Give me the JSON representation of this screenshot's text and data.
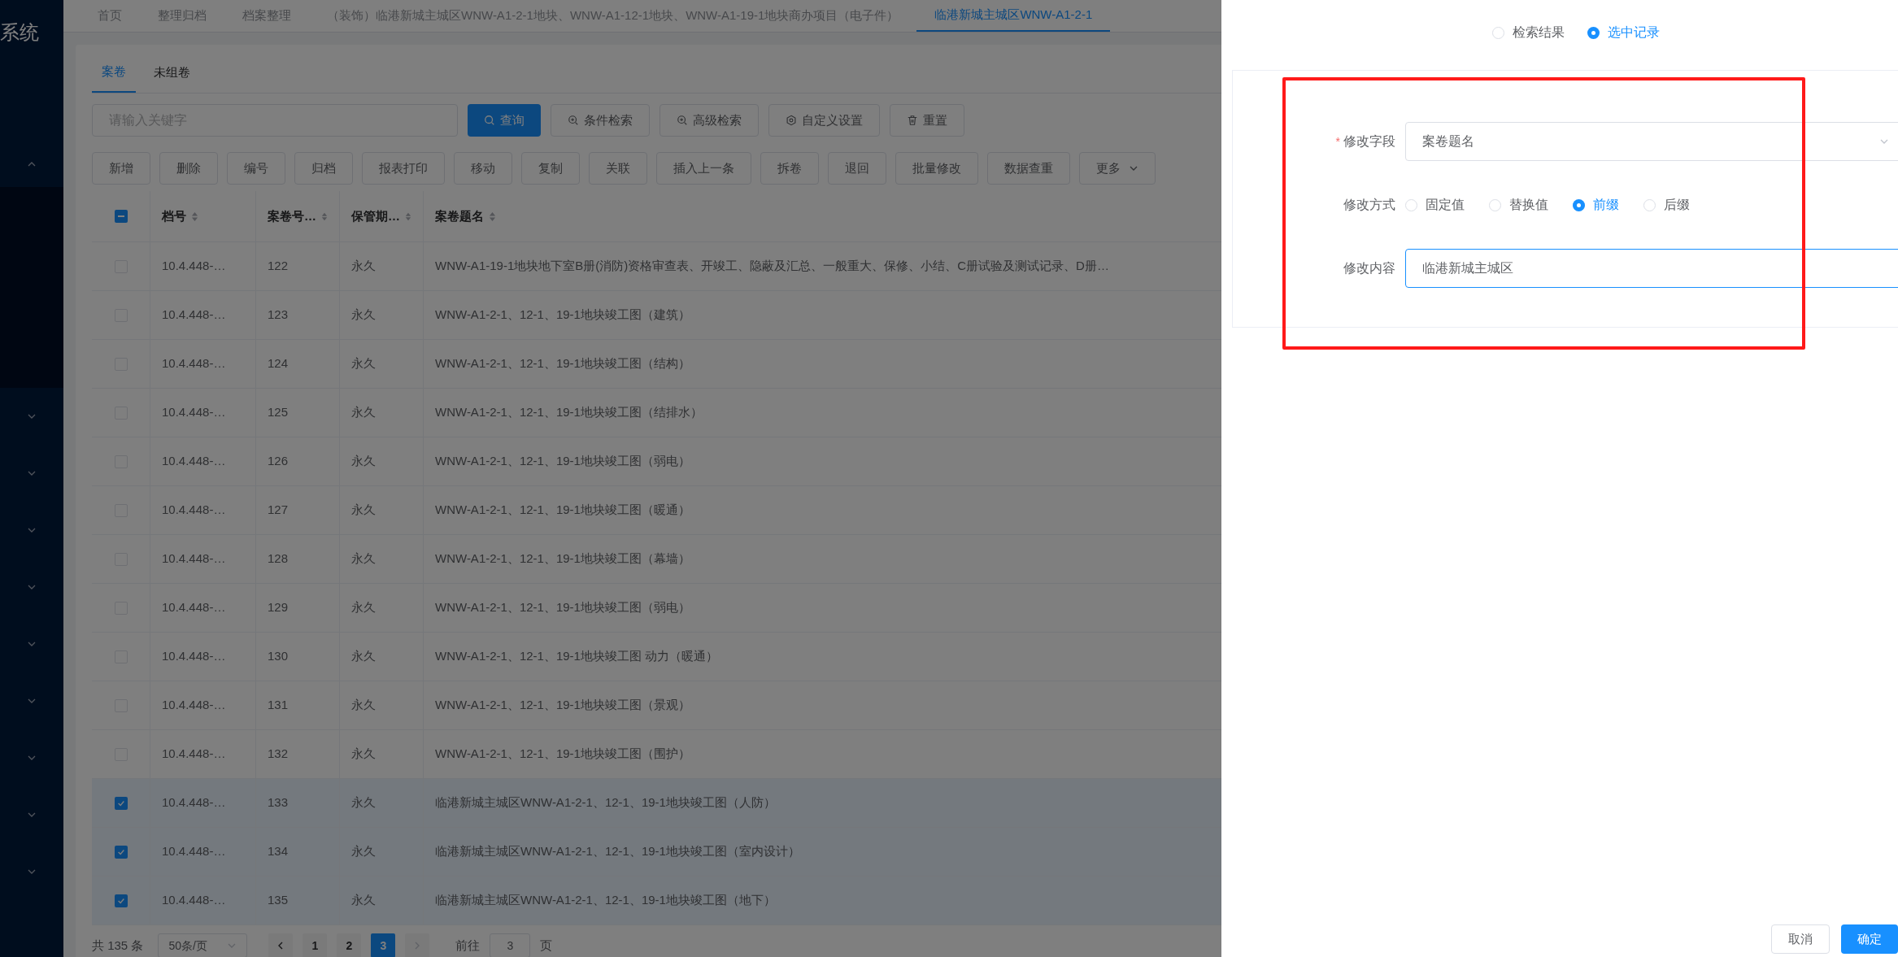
{
  "sidebar": {
    "title": "系统",
    "menu_groups": [
      {
        "expanded": true
      },
      {
        "expanded": false
      },
      {
        "expanded": false
      },
      {
        "expanded": false
      },
      {
        "expanded": false
      },
      {
        "expanded": false
      },
      {
        "expanded": false
      },
      {
        "expanded": false
      },
      {
        "expanded": false
      },
      {
        "expanded": false
      }
    ]
  },
  "page_tabs": [
    {
      "label": "首页",
      "selected": false
    },
    {
      "label": "整理归档",
      "selected": false
    },
    {
      "label": "档案整理",
      "selected": false
    },
    {
      "label": "（装饰）临港新城主城区WNW-A1-2-1地块、WNW-A1-12-1地块、WNW-A1-19-1地块商办项目（电子件）",
      "selected": false
    },
    {
      "label": "临港新城主城区WNW-A1-2-1",
      "selected": true
    }
  ],
  "sub_tabs": [
    {
      "label": "案卷",
      "selected": true
    },
    {
      "label": "未组卷",
      "selected": false
    }
  ],
  "search": {
    "placeholder": "请输入关键字"
  },
  "search_buttons": [
    {
      "label": "查询",
      "kind": "primary"
    },
    {
      "label": "条件检索",
      "kind": "zoom"
    },
    {
      "label": "高级检索",
      "kind": "zoom"
    },
    {
      "label": "自定义设置",
      "kind": "gear"
    },
    {
      "label": "重置",
      "kind": "trash"
    }
  ],
  "action_buttons": [
    {
      "label": "新增",
      "kind": "plain"
    },
    {
      "label": "删除",
      "kind": "plain"
    },
    {
      "label": "编号",
      "kind": "plain"
    },
    {
      "label": "归档",
      "kind": "plain"
    },
    {
      "label": "报表打印",
      "kind": "plain"
    },
    {
      "label": "移动",
      "kind": "plain"
    },
    {
      "label": "复制",
      "kind": "plain"
    },
    {
      "label": "关联",
      "kind": "plain"
    },
    {
      "label": "插入上一条",
      "kind": "plain"
    },
    {
      "label": "拆卷",
      "kind": "plain"
    },
    {
      "label": "退回",
      "kind": "plain"
    },
    {
      "label": "批量修改",
      "kind": "plain"
    },
    {
      "label": "数据查重",
      "kind": "plain"
    },
    {
      "label": "更多",
      "kind": "dropdown"
    }
  ],
  "table": {
    "select_all": {
      "indeterminate": true
    },
    "columns": [
      "档号",
      "案卷号…",
      "保管期…",
      "案卷题名"
    ],
    "rows": [
      {
        "selected": false,
        "cells": [
          "10.4.448-…",
          "122",
          "永久",
          "WNW-A1-19-1地块地下室B册(消防)资格审查表、开竣工、隐蔽及汇总、一般重大、保修、小结、C册试验及测试记录、D册…"
        ]
      },
      {
        "selected": false,
        "cells": [
          "10.4.448-…",
          "123",
          "永久",
          "WNW-A1-2-1、12-1、19-1地块竣工图（建筑）"
        ]
      },
      {
        "selected": false,
        "cells": [
          "10.4.448-…",
          "124",
          "永久",
          "WNW-A1-2-1、12-1、19-1地块竣工图（结构）"
        ]
      },
      {
        "selected": false,
        "cells": [
          "10.4.448-…",
          "125",
          "永久",
          "WNW-A1-2-1、12-1、19-1地块竣工图（结排水）"
        ]
      },
      {
        "selected": false,
        "cells": [
          "10.4.448-…",
          "126",
          "永久",
          "WNW-A1-2-1、12-1、19-1地块竣工图（弱电）"
        ]
      },
      {
        "selected": false,
        "cells": [
          "10.4.448-…",
          "127",
          "永久",
          "WNW-A1-2-1、12-1、19-1地块竣工图（暖通）"
        ]
      },
      {
        "selected": false,
        "cells": [
          "10.4.448-…",
          "128",
          "永久",
          "WNW-A1-2-1、12-1、19-1地块竣工图（幕墙）"
        ]
      },
      {
        "selected": false,
        "cells": [
          "10.4.448-…",
          "129",
          "永久",
          "WNW-A1-2-1、12-1、19-1地块竣工图（弱电）"
        ]
      },
      {
        "selected": false,
        "cells": [
          "10.4.448-…",
          "130",
          "永久",
          "WNW-A1-2-1、12-1、19-1地块竣工图 动力（暖通）"
        ]
      },
      {
        "selected": false,
        "cells": [
          "10.4.448-…",
          "131",
          "永久",
          "WNW-A1-2-1、12-1、19-1地块竣工图（景观）"
        ]
      },
      {
        "selected": false,
        "cells": [
          "10.4.448-…",
          "132",
          "永久",
          "WNW-A1-2-1、12-1、19-1地块竣工图（围护）"
        ]
      },
      {
        "selected": true,
        "cells": [
          "10.4.448-…",
          "133",
          "永久",
          "临港新城主城区WNW-A1-2-1、12-1、19-1地块竣工图（人防）"
        ]
      },
      {
        "selected": true,
        "cells": [
          "10.4.448-…",
          "134",
          "永久",
          "临港新城主城区WNW-A1-2-1、12-1、19-1地块竣工图（室内设计）"
        ]
      },
      {
        "selected": true,
        "cells": [
          "10.4.448-…",
          "135",
          "永久",
          "临港新城主城区WNW-A1-2-1、12-1、19-1地块竣工图（地下）"
        ]
      }
    ]
  },
  "pagination": {
    "total": "共 135 条",
    "page_size": "50条/页",
    "pages": [
      {
        "label": "1",
        "selected": false
      },
      {
        "label": "2",
        "selected": false
      },
      {
        "label": "3",
        "selected": true
      }
    ],
    "goto_label": "前往",
    "goto_value": "3",
    "goto_suffix": "页"
  },
  "drawer": {
    "scope_options": [
      {
        "label": "检索结果",
        "selected": false
      },
      {
        "label": "选中记录",
        "selected": true
      }
    ],
    "field": {
      "label": "修改字段",
      "required_mark": "*",
      "value": "案卷题名"
    },
    "mode": {
      "label": "修改方式",
      "options": [
        {
          "label": "固定值",
          "selected": false
        },
        {
          "label": "替换值",
          "selected": false
        },
        {
          "label": "前缀",
          "selected": true
        },
        {
          "label": "后缀",
          "selected": false
        }
      ]
    },
    "content": {
      "label": "修改内容",
      "value": "临港新城主城区"
    },
    "buttons": [
      {
        "label": "取消",
        "kind": "default"
      },
      {
        "label": "确定",
        "kind": "primary"
      }
    ]
  }
}
